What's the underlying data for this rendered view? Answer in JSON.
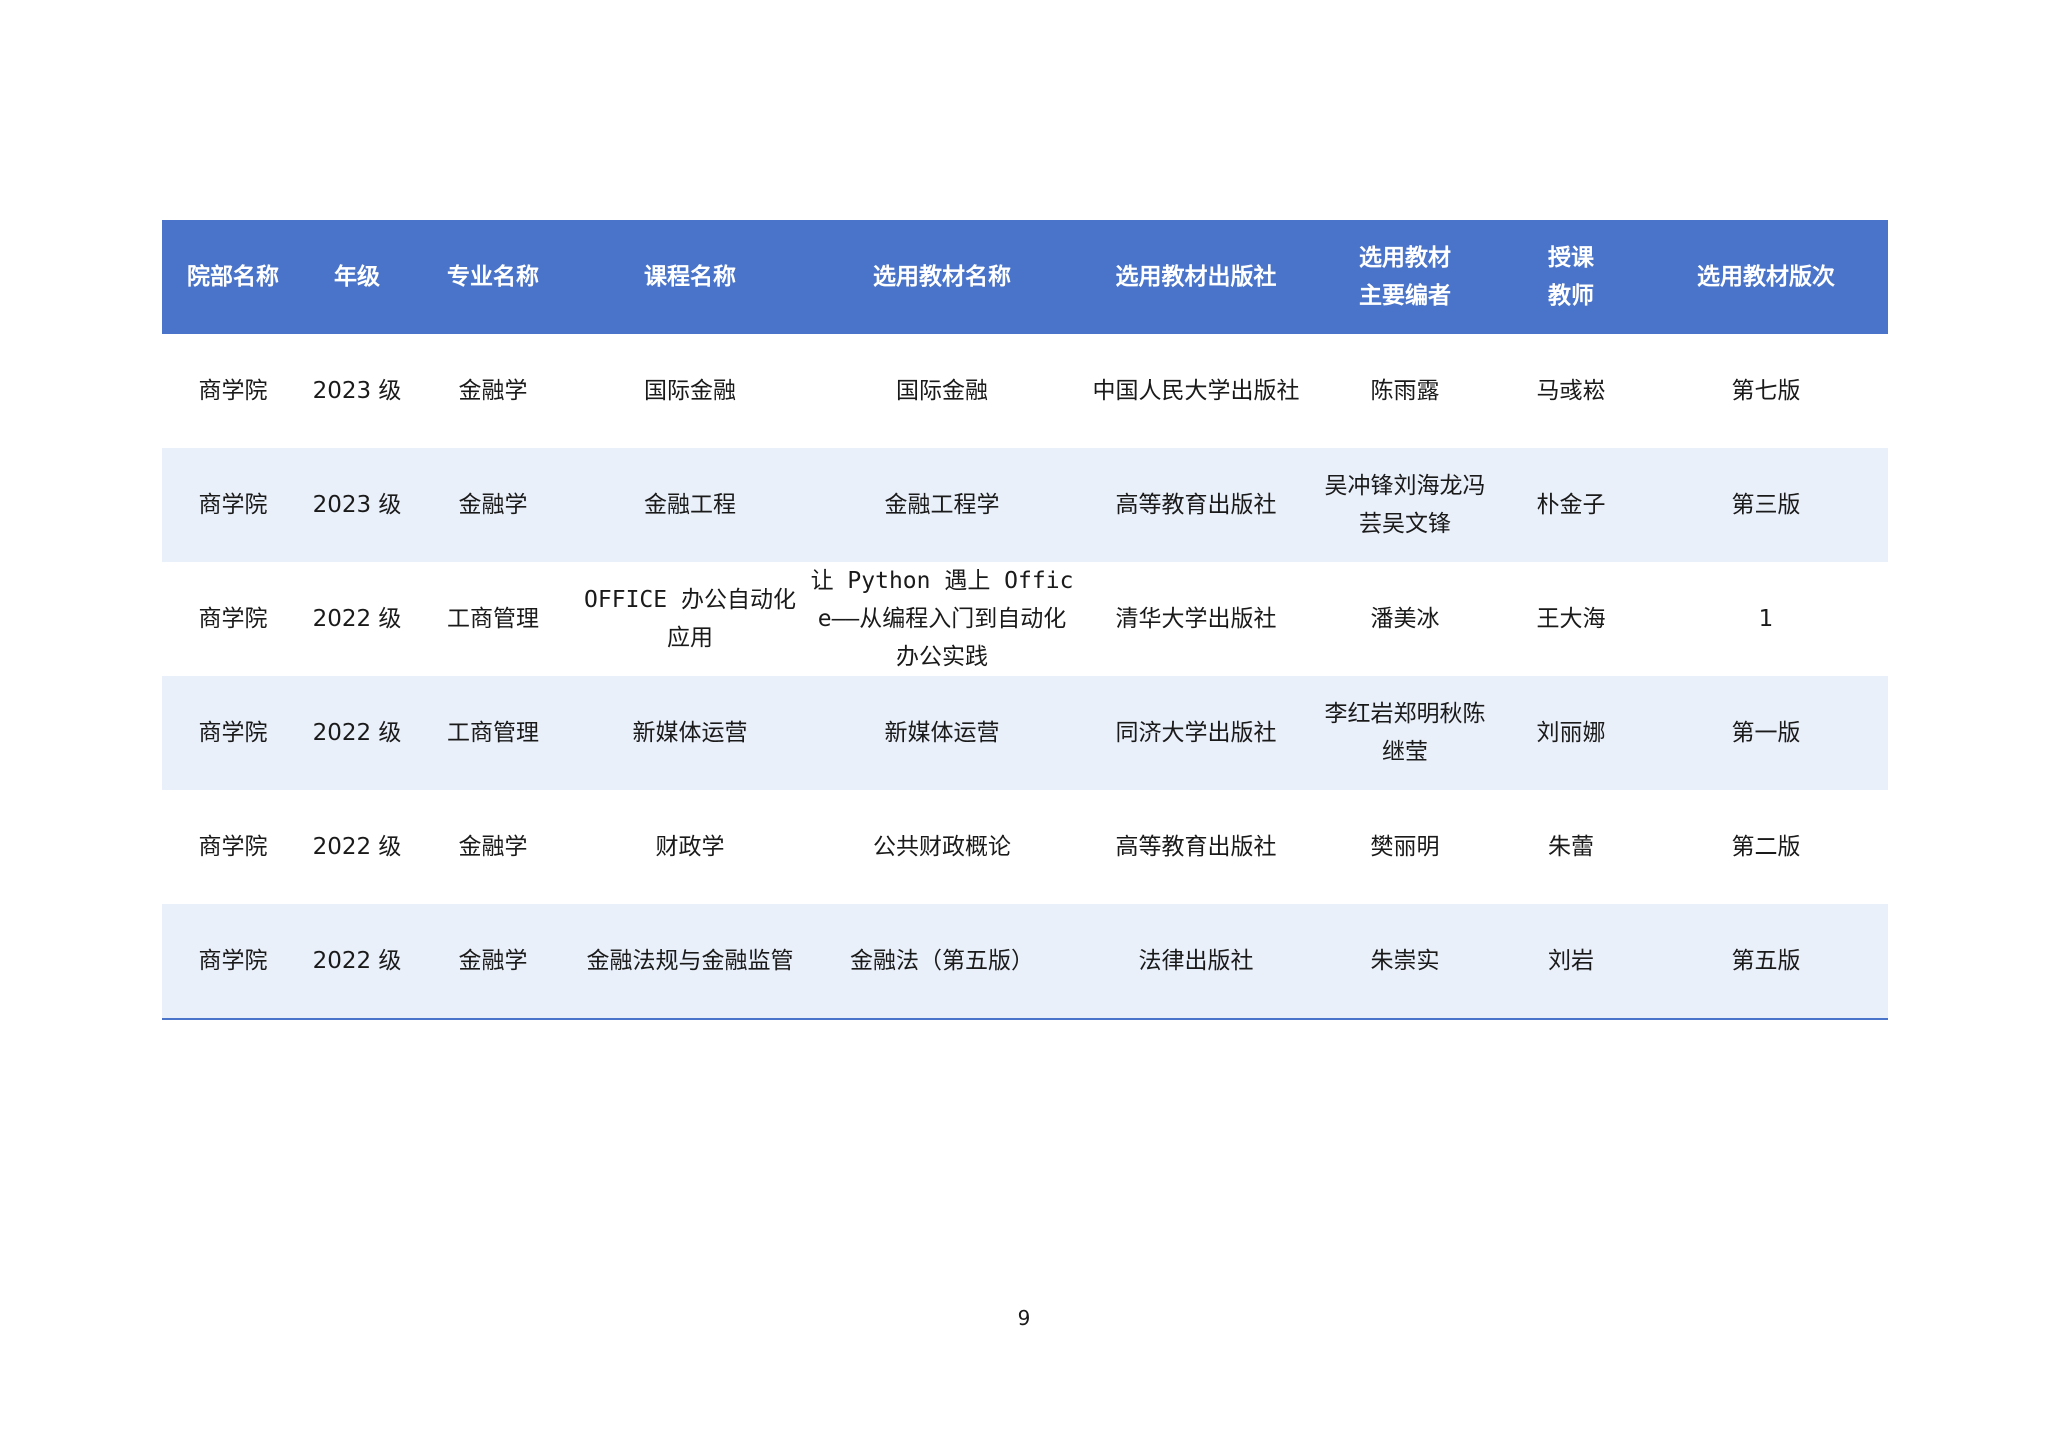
{
  "table": {
    "headers": [
      {
        "lines": [
          "院部名称"
        ]
      },
      {
        "lines": [
          "年级"
        ]
      },
      {
        "lines": [
          "专业名称"
        ]
      },
      {
        "lines": [
          "课程名称"
        ]
      },
      {
        "lines": [
          "选用教材名称"
        ]
      },
      {
        "lines": [
          "选用教材出版社"
        ]
      },
      {
        "lines": [
          "选用教材",
          "主要编者"
        ]
      },
      {
        "lines": [
          "授课",
          "教师"
        ]
      },
      {
        "lines": [
          "选用教材版次"
        ]
      }
    ],
    "rows": [
      [
        "商学院",
        "2023 级",
        "金融学",
        "国际金融",
        "国际金融",
        "中国人民大学出版社",
        "陈雨露",
        "马彧崧",
        "第七版"
      ],
      [
        "商学院",
        "2023 级",
        "金融学",
        "金融工程",
        "金融工程学",
        "高等教育出版社",
        "吴冲锋刘海龙冯芸吴文锋",
        "朴金子",
        "第三版"
      ],
      [
        "商学院",
        "2022 级",
        "工商管理",
        "OFFICE 办公自动化应用",
        "让 Python 遇上 Office——从编程入门到自动化办公实践",
        "清华大学出版社",
        "潘美冰",
        "王大海",
        "1"
      ],
      [
        "商学院",
        "2022 级",
        "工商管理",
        "新媒体运营",
        "新媒体运营",
        "同济大学出版社",
        "李红岩郑明秋陈继莹",
        "刘丽娜",
        "第一版"
      ],
      [
        "商学院",
        "2022 级",
        "金融学",
        "财政学",
        "公共财政概论",
        "高等教育出版社",
        "樊丽明",
        "朱蕾",
        "第二版"
      ],
      [
        "商学院",
        "2022 级",
        "金融学",
        "金融法规与金融监管",
        "金融法（第五版）",
        "法律出版社",
        "朱崇实",
        "刘岩",
        "第五版"
      ]
    ]
  },
  "page_number": "9",
  "colors": {
    "header_bg": "#4a74c9",
    "header_text": "#ffffff",
    "stripe_bg": "#eaf0fa"
  }
}
